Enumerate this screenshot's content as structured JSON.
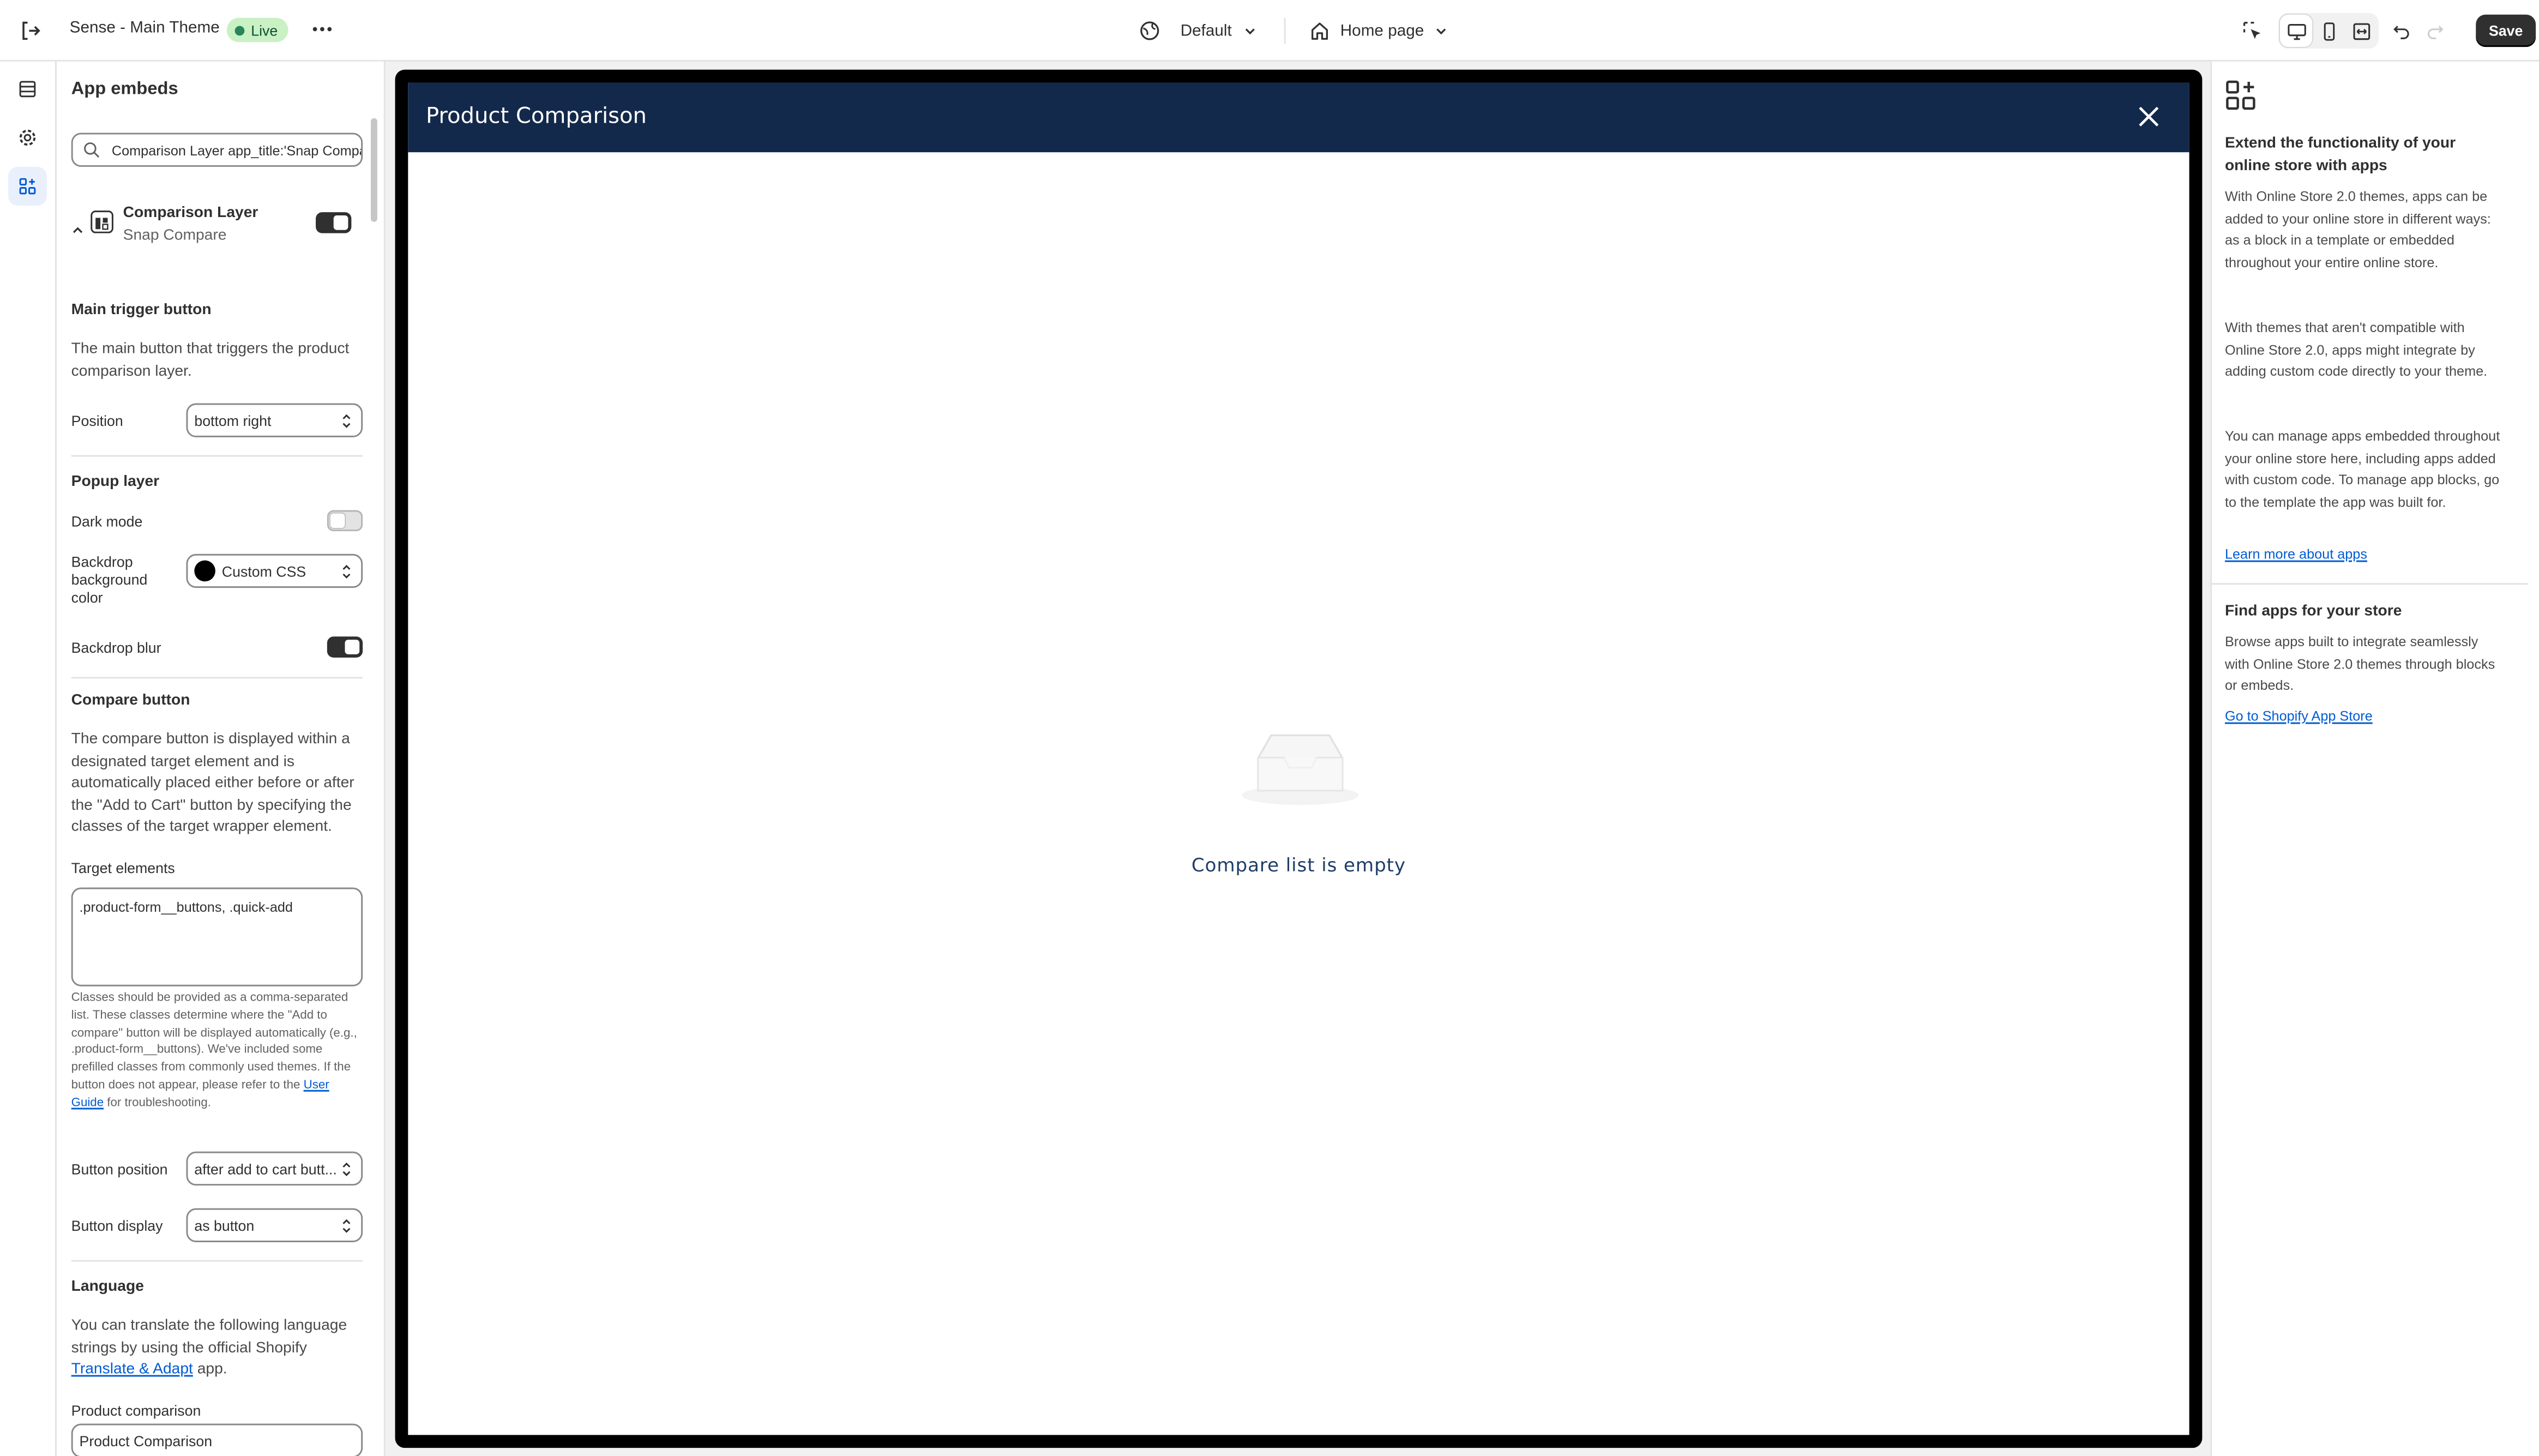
{
  "topbar": {
    "theme_name": "Sense - Main Theme",
    "live_badge": "Live",
    "preset": "Default",
    "page": "Home page",
    "save_label": "Save"
  },
  "panel": {
    "title": "App embeds",
    "search_value": "Comparison Layer app_title:'Snap Compare'",
    "embed": {
      "name": "Comparison Layer",
      "app": "Snap Compare",
      "enabled": true
    },
    "main_trigger": {
      "heading": "Main trigger button",
      "description": "The main button that triggers the product comparison layer.",
      "position_label": "Position",
      "position_value": "bottom right"
    },
    "popup_layer": {
      "heading": "Popup layer",
      "dark_mode_label": "Dark mode",
      "dark_mode_on": false,
      "backdrop_color_label": "Backdrop background color",
      "backdrop_color_value": "Custom CSS",
      "backdrop_blur_label": "Backdrop blur",
      "backdrop_blur_on": true
    },
    "compare_button": {
      "heading": "Compare button",
      "description": "The compare button is displayed within a designated target element and is automatically placed either before or after the \"Add to Cart\" button by specifying the classes of the target wrapper element.",
      "target_label": "Target elements",
      "target_value": ".product-form__buttons, .quick-add",
      "help_text": "Classes should be provided as a comma-separated list. These classes determine where the \"Add to compare\" button will be displayed automatically (e.g., .product-form__buttons). We've included some prefilled classes from commonly used themes. If the button does not appear, please refer to the",
      "help_link": "User Guide",
      "help_suffix": "for troubleshooting.",
      "position_label": "Button position",
      "position_value": "after add to cart butt...",
      "display_label": "Button display",
      "display_value": "as button"
    },
    "language": {
      "heading": "Language",
      "description": "You can translate the following language strings by using the official Shopify",
      "link": "Translate & Adapt",
      "suffix": "app.",
      "product_comparison_label": "Product comparison",
      "product_comparison_value": "Product Comparison"
    }
  },
  "preview": {
    "modal_title": "Product Comparison",
    "empty_text": "Compare list is empty"
  },
  "info": {
    "heading1": "Extend the functionality of your online store with apps",
    "p1": "With Online Store 2.0 themes, apps can be added to your online store in different ways: as a block in a template or embedded throughout your entire online store.",
    "p2": "With themes that aren't compatible with Online Store 2.0, apps might integrate by adding custom code directly to your theme.",
    "p3": "You can manage apps embedded throughout your online store here, including apps added with custom code. To manage app blocks, go to the template the app was built for.",
    "link1": "Learn more about apps",
    "heading2": "Find apps for your store",
    "p4": "Browse apps built to integrate seamlessly with Online Store 2.0 themes through blocks or embeds.",
    "link2": "Go to Shopify App Store"
  },
  "colors": {
    "modal_header": "#13294b",
    "save_button": "#303030",
    "live_badge_bg": "#c9f1c4",
    "link": "#005bd3"
  },
  "icons": [
    "exit-icon",
    "more-icon",
    "globe-icon",
    "home-icon",
    "chevron-down-icon",
    "inspect-icon",
    "desktop-icon",
    "mobile-icon",
    "fullwidth-icon",
    "undo-icon",
    "redo-icon",
    "sections-icon",
    "settings-icon",
    "app-embeds-icon",
    "search-icon",
    "close-icon",
    "inbox-icon",
    "apps-icon"
  ]
}
